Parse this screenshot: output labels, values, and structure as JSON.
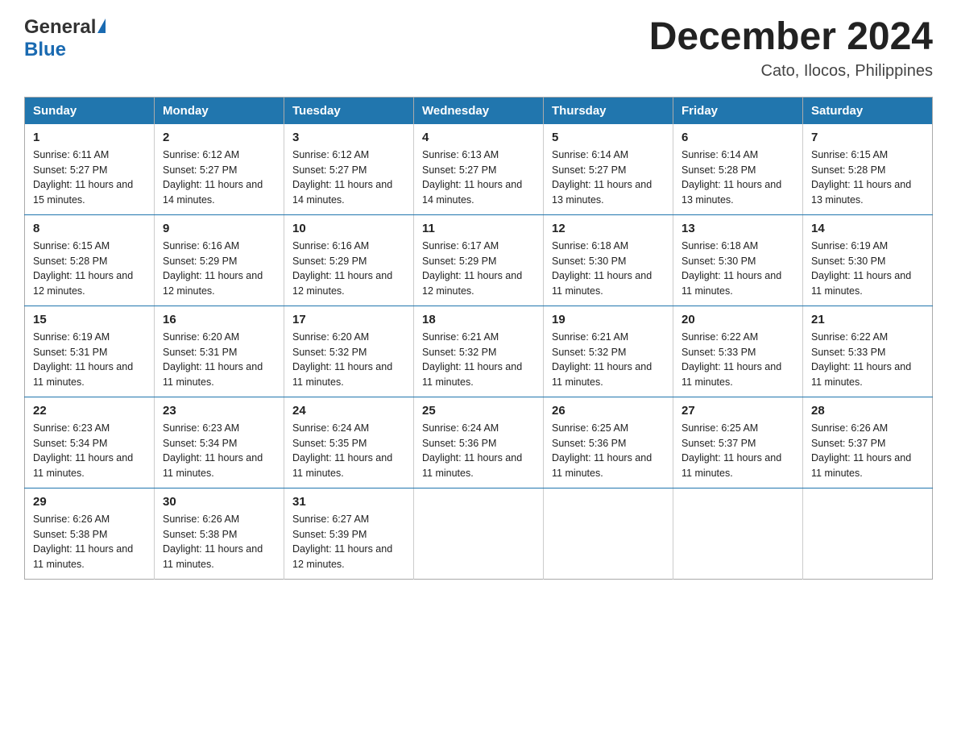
{
  "logo": {
    "general": "General",
    "blue": "Blue"
  },
  "title": "December 2024",
  "subtitle": "Cato, Ilocos, Philippines",
  "days_header": [
    "Sunday",
    "Monday",
    "Tuesday",
    "Wednesday",
    "Thursday",
    "Friday",
    "Saturday"
  ],
  "weeks": [
    [
      {
        "num": "1",
        "sunrise": "6:11 AM",
        "sunset": "5:27 PM",
        "daylight": "11 hours and 15 minutes."
      },
      {
        "num": "2",
        "sunrise": "6:12 AM",
        "sunset": "5:27 PM",
        "daylight": "11 hours and 14 minutes."
      },
      {
        "num": "3",
        "sunrise": "6:12 AM",
        "sunset": "5:27 PM",
        "daylight": "11 hours and 14 minutes."
      },
      {
        "num": "4",
        "sunrise": "6:13 AM",
        "sunset": "5:27 PM",
        "daylight": "11 hours and 14 minutes."
      },
      {
        "num": "5",
        "sunrise": "6:14 AM",
        "sunset": "5:27 PM",
        "daylight": "11 hours and 13 minutes."
      },
      {
        "num": "6",
        "sunrise": "6:14 AM",
        "sunset": "5:28 PM",
        "daylight": "11 hours and 13 minutes."
      },
      {
        "num": "7",
        "sunrise": "6:15 AM",
        "sunset": "5:28 PM",
        "daylight": "11 hours and 13 minutes."
      }
    ],
    [
      {
        "num": "8",
        "sunrise": "6:15 AM",
        "sunset": "5:28 PM",
        "daylight": "11 hours and 12 minutes."
      },
      {
        "num": "9",
        "sunrise": "6:16 AM",
        "sunset": "5:29 PM",
        "daylight": "11 hours and 12 minutes."
      },
      {
        "num": "10",
        "sunrise": "6:16 AM",
        "sunset": "5:29 PM",
        "daylight": "11 hours and 12 minutes."
      },
      {
        "num": "11",
        "sunrise": "6:17 AM",
        "sunset": "5:29 PM",
        "daylight": "11 hours and 12 minutes."
      },
      {
        "num": "12",
        "sunrise": "6:18 AM",
        "sunset": "5:30 PM",
        "daylight": "11 hours and 11 minutes."
      },
      {
        "num": "13",
        "sunrise": "6:18 AM",
        "sunset": "5:30 PM",
        "daylight": "11 hours and 11 minutes."
      },
      {
        "num": "14",
        "sunrise": "6:19 AM",
        "sunset": "5:30 PM",
        "daylight": "11 hours and 11 minutes."
      }
    ],
    [
      {
        "num": "15",
        "sunrise": "6:19 AM",
        "sunset": "5:31 PM",
        "daylight": "11 hours and 11 minutes."
      },
      {
        "num": "16",
        "sunrise": "6:20 AM",
        "sunset": "5:31 PM",
        "daylight": "11 hours and 11 minutes."
      },
      {
        "num": "17",
        "sunrise": "6:20 AM",
        "sunset": "5:32 PM",
        "daylight": "11 hours and 11 minutes."
      },
      {
        "num": "18",
        "sunrise": "6:21 AM",
        "sunset": "5:32 PM",
        "daylight": "11 hours and 11 minutes."
      },
      {
        "num": "19",
        "sunrise": "6:21 AM",
        "sunset": "5:32 PM",
        "daylight": "11 hours and 11 minutes."
      },
      {
        "num": "20",
        "sunrise": "6:22 AM",
        "sunset": "5:33 PM",
        "daylight": "11 hours and 11 minutes."
      },
      {
        "num": "21",
        "sunrise": "6:22 AM",
        "sunset": "5:33 PM",
        "daylight": "11 hours and 11 minutes."
      }
    ],
    [
      {
        "num": "22",
        "sunrise": "6:23 AM",
        "sunset": "5:34 PM",
        "daylight": "11 hours and 11 minutes."
      },
      {
        "num": "23",
        "sunrise": "6:23 AM",
        "sunset": "5:34 PM",
        "daylight": "11 hours and 11 minutes."
      },
      {
        "num": "24",
        "sunrise": "6:24 AM",
        "sunset": "5:35 PM",
        "daylight": "11 hours and 11 minutes."
      },
      {
        "num": "25",
        "sunrise": "6:24 AM",
        "sunset": "5:36 PM",
        "daylight": "11 hours and 11 minutes."
      },
      {
        "num": "26",
        "sunrise": "6:25 AM",
        "sunset": "5:36 PM",
        "daylight": "11 hours and 11 minutes."
      },
      {
        "num": "27",
        "sunrise": "6:25 AM",
        "sunset": "5:37 PM",
        "daylight": "11 hours and 11 minutes."
      },
      {
        "num": "28",
        "sunrise": "6:26 AM",
        "sunset": "5:37 PM",
        "daylight": "11 hours and 11 minutes."
      }
    ],
    [
      {
        "num": "29",
        "sunrise": "6:26 AM",
        "sunset": "5:38 PM",
        "daylight": "11 hours and 11 minutes."
      },
      {
        "num": "30",
        "sunrise": "6:26 AM",
        "sunset": "5:38 PM",
        "daylight": "11 hours and 11 minutes."
      },
      {
        "num": "31",
        "sunrise": "6:27 AM",
        "sunset": "5:39 PM",
        "daylight": "11 hours and 12 minutes."
      },
      null,
      null,
      null,
      null
    ]
  ],
  "labels": {
    "sunrise": "Sunrise:",
    "sunset": "Sunset:",
    "daylight": "Daylight:"
  }
}
